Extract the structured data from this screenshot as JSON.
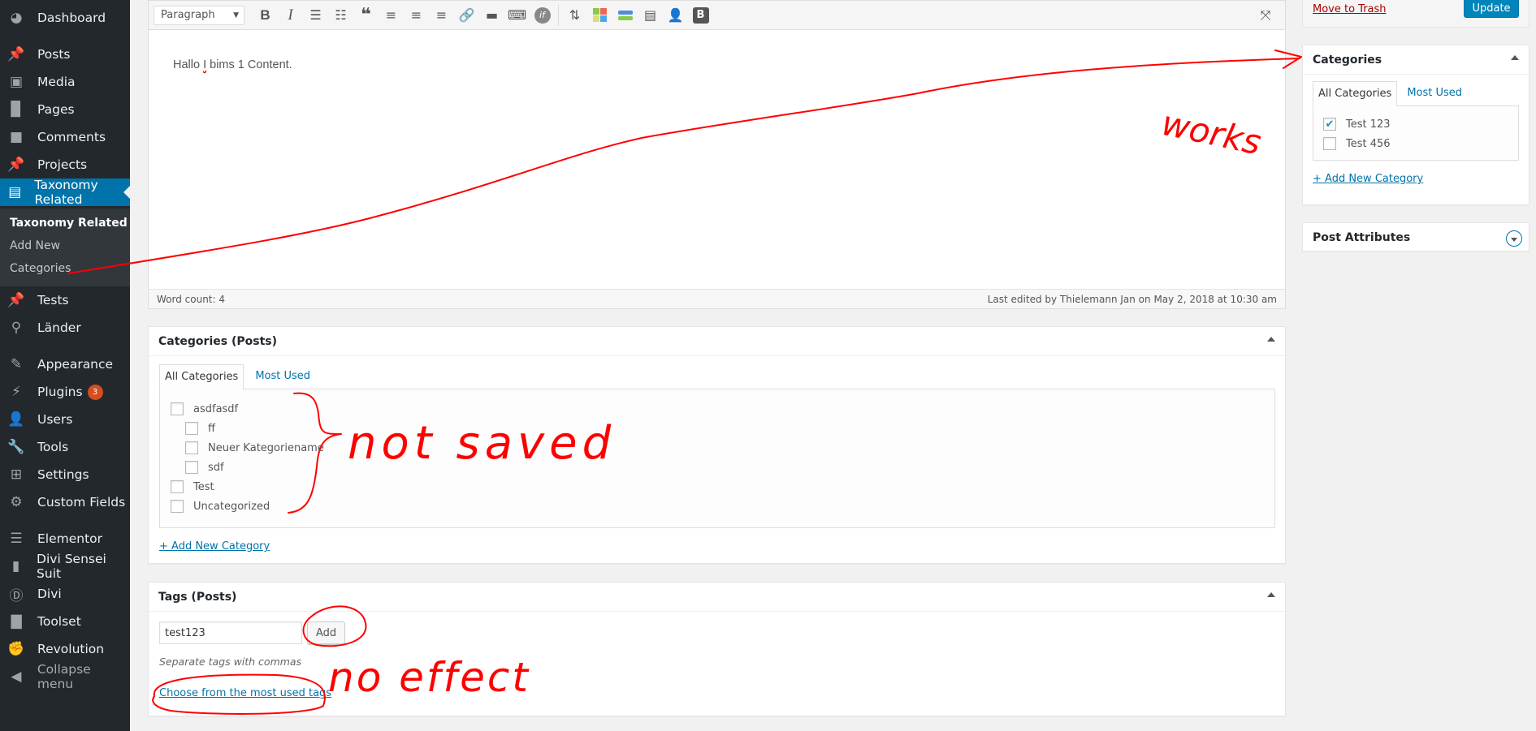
{
  "sidebar": {
    "items": [
      {
        "label": "Dashboard",
        "icon": "dashboard-icon"
      },
      {
        "label": "Posts",
        "icon": "pin-icon"
      },
      {
        "label": "Media",
        "icon": "media-icon"
      },
      {
        "label": "Pages",
        "icon": "pages-icon"
      },
      {
        "label": "Comments",
        "icon": "comment-icon"
      },
      {
        "label": "Projects",
        "icon": "pin-icon"
      },
      {
        "label": "Taxonomy Related",
        "icon": "document-icon",
        "active": true
      },
      {
        "label": "Tests",
        "icon": "pin-icon"
      },
      {
        "label": "Länder",
        "icon": "location-icon"
      },
      {
        "label": "Appearance",
        "icon": "brush-icon"
      },
      {
        "label": "Plugins",
        "icon": "plugin-icon",
        "badge": "3"
      },
      {
        "label": "Users",
        "icon": "user-icon"
      },
      {
        "label": "Tools",
        "icon": "wrench-icon"
      },
      {
        "label": "Settings",
        "icon": "settings-icon"
      },
      {
        "label": "Custom Fields",
        "icon": "gear-icon"
      },
      {
        "label": "Elementor",
        "icon": "elementor-icon"
      },
      {
        "label": "Divi Sensei Suit",
        "icon": "tie-icon"
      },
      {
        "label": "Divi",
        "icon": "divi-icon"
      },
      {
        "label": "Toolset",
        "icon": "toolset-icon"
      },
      {
        "label": "Revolution",
        "icon": "fist-icon"
      }
    ],
    "submenu": [
      {
        "label": "Taxonomy Related",
        "current": true
      },
      {
        "label": "Add New"
      },
      {
        "label": "Categories"
      }
    ],
    "collapse_label": "Collapse menu"
  },
  "editor": {
    "format_select": "Paragraph",
    "content": {
      "before": "Hallo ",
      "misspelled": "I",
      "after": " bims 1 Content."
    },
    "word_count": "Word count: 4",
    "last_edited": "Last edited by Thielemann Jan on May 2, 2018 at 10:30 am"
  },
  "publish": {
    "trash_label": "Move to Trash",
    "update_label": "Update"
  },
  "categories_posts": {
    "title": "Categories (Posts)",
    "tabs": [
      "All Categories",
      "Most Used"
    ],
    "items": [
      {
        "label": "asdfasdf",
        "checked": false,
        "level": 0
      },
      {
        "label": "ff",
        "checked": false,
        "level": 1
      },
      {
        "label": "Neuer Kategoriename",
        "checked": false,
        "level": 1
      },
      {
        "label": "sdf",
        "checked": false,
        "level": 1
      },
      {
        "label": "Test",
        "checked": false,
        "level": 0
      },
      {
        "label": "Uncategorized",
        "checked": false,
        "level": 0
      }
    ],
    "add_new": "+ Add New Category"
  },
  "tags_posts": {
    "title": "Tags (Posts)",
    "input_value": "test123",
    "add_label": "Add",
    "howto": "Separate tags with commas",
    "most_used_link": "Choose from the most used tags"
  },
  "categories_side": {
    "title": "Categories",
    "tabs": [
      "All Categories",
      "Most Used"
    ],
    "items": [
      {
        "label": "Test 123",
        "checked": true
      },
      {
        "label": "Test 456",
        "checked": false
      }
    ],
    "add_new": "+ Add New Category"
  },
  "post_attributes": {
    "title": "Post Attributes"
  },
  "annotations": {
    "works": "works",
    "not_saved": "not saved",
    "no_effect": "no effect",
    "color": "#ff0000"
  }
}
